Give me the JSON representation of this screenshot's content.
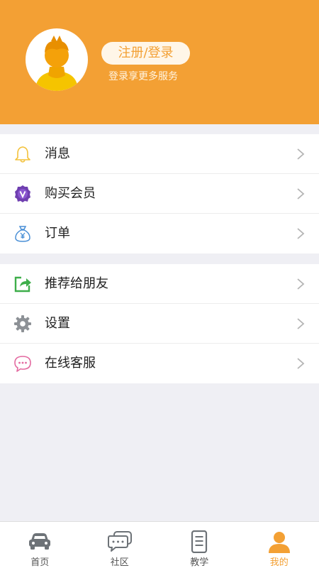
{
  "profile": {
    "login_label": "注册/登录",
    "subtitle": "登录享更多服务"
  },
  "menu_group_1": [
    {
      "label": "消息",
      "icon": "bell-icon"
    },
    {
      "label": "购买会员",
      "icon": "vip-badge-icon"
    },
    {
      "label": "订单",
      "icon": "money-bag-icon"
    }
  ],
  "menu_group_2": [
    {
      "label": "推荐给朋友",
      "icon": "share-icon"
    },
    {
      "label": "设置",
      "icon": "gear-icon"
    },
    {
      "label": "在线客服",
      "icon": "chat-support-icon"
    }
  ],
  "tabbar": [
    {
      "label": "首页",
      "icon": "car-icon"
    },
    {
      "label": "社区",
      "icon": "chat-bubbles-icon"
    },
    {
      "label": "教学",
      "icon": "document-icon"
    },
    {
      "label": "我的",
      "icon": "person-icon",
      "active": true
    }
  ],
  "colors": {
    "accent": "#f3a034",
    "background": "#efeff4"
  }
}
